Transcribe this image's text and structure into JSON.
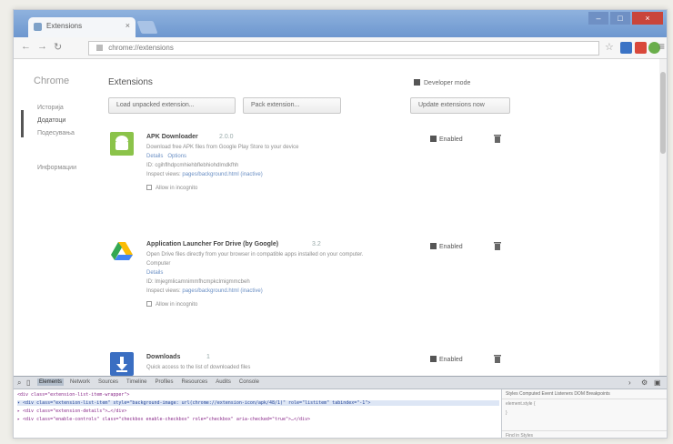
{
  "browser": {
    "tab_title": "Extensions",
    "url": "chrome://extensions",
    "new_tab_label": ""
  },
  "sidebar": {
    "title": "Chrome",
    "items": [
      {
        "label": "Историја"
      },
      {
        "label": "Додатоци"
      },
      {
        "label": "Подесувања"
      },
      {
        "label": "Информации"
      }
    ]
  },
  "main": {
    "title": "Extensions",
    "developer_mode_label": "Developer mode",
    "buttons": {
      "load_unpacked": "Load unpacked extension...",
      "pack": "Pack extension...",
      "update": "Update extensions now"
    }
  },
  "extensions": [
    {
      "name": "APK Downloader",
      "version": "2.0.0",
      "description": "Download free APK files from Google Play Store to your device",
      "details_label": "Details",
      "options_label": "Options",
      "id_line": "ID: cgihflhdpcmhiehbflebhiohdlmdkfhh",
      "inspect_prefix": "Inspect views:",
      "inspect_link": "pages/background.html (inactive)",
      "incognito_label": "Allow in incognito",
      "enabled_label": "Enabled",
      "logo_color": "#8bc34a"
    },
    {
      "name": "Application Launcher For Drive (by Google)",
      "version": "3.2",
      "description": "Open Drive files directly from your browser in compatible apps installed on your computer.",
      "sub_label": "Computer",
      "details_label": "Details",
      "id_line": "ID: lmjegmlicamnimmfhcmpkclmigmmcbeh",
      "inspect_prefix": "Inspect views:",
      "inspect_link": "pages/background.html (inactive)",
      "incognito_label": "Allow in incognito",
      "enabled_label": "Enabled"
    },
    {
      "name": "Downloads",
      "version": "1",
      "description": "Quick access to the list of downloaded files",
      "enabled_label": "Enabled",
      "logo_color": "#3a6ec2"
    }
  ],
  "devtools": {
    "tabs": [
      "Elements",
      "Network",
      "Sources",
      "Timeline",
      "Profiles",
      "Resources",
      "Audits",
      "Console"
    ],
    "active_tab": "Elements",
    "code_lines": [
      "<div class=\"extension-list-item-wrapper\">",
      "▾ <div class=\"extension-list-item\" style=\"background-image: url(chrome://extension-icon/apk/48/1)\" role=\"listitem\" tabindex=\"-1\">",
      "  ▸ <div class=\"extension-details\">…</div>",
      "  ▸ <div class=\"enable-controls\" class=\"checkbox enable-checkbox\" role=\"checkbox\" aria-checked=\"true\">…</div>"
    ],
    "side_tabs": "Styles  Computed  Event Listeners  DOM Breakpoints",
    "side_line_1": "element.style {",
    "side_line_2": "}",
    "find_label": "Find in Styles"
  },
  "colors": {
    "title_bar": "#7aa0d3",
    "drive_blue": "#4285f4",
    "drive_yellow": "#fbbc05",
    "drive_green": "#34a853"
  }
}
